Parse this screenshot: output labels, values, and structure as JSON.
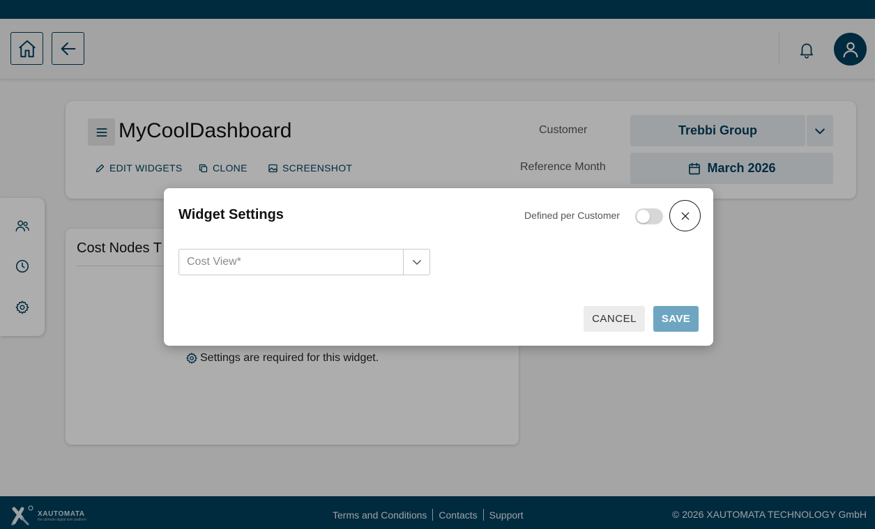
{
  "app": {
    "brand_text": "XAUTOMATA",
    "brand_tagline": "the ultimate digital twin platform"
  },
  "header": {
    "home_icon": "home-icon",
    "back_icon": "arrow-left-icon",
    "notifications_icon": "bell-icon",
    "avatar_icon": "user-icon"
  },
  "sidebar": {
    "items": [
      {
        "icon": "users-icon"
      },
      {
        "icon": "clock-icon"
      },
      {
        "icon": "gear-icon"
      }
    ]
  },
  "dashboard": {
    "title": "MyCoolDashboard",
    "actions": {
      "edit_widgets": "EDIT WIDGETS",
      "clone": "CLONE",
      "screenshot": "SCREENSHOT"
    },
    "customer_label": "Customer",
    "customer_value": "Trebbi Group",
    "reference_month_label": "Reference Month",
    "reference_month_value": "March 2026"
  },
  "widget": {
    "title": "Cost Nodes T",
    "message": "Settings are required for this widget."
  },
  "modal": {
    "title": "Widget Settings",
    "toggle_label": "Defined per Customer",
    "toggle_on": false,
    "cost_view_placeholder": "Cost View*",
    "cancel_label": "CANCEL",
    "save_label": "SAVE"
  },
  "footer": {
    "links": [
      "Terms and Conditions",
      "Contacts",
      "Support"
    ],
    "copyright": "© 2026 XAUTOMATA TECHNOLOGY GmbH"
  },
  "colors": {
    "primary": "#003e5c",
    "save_button": "#6ea6c2",
    "overlay": "rgba(0,0,0,0.32)"
  }
}
